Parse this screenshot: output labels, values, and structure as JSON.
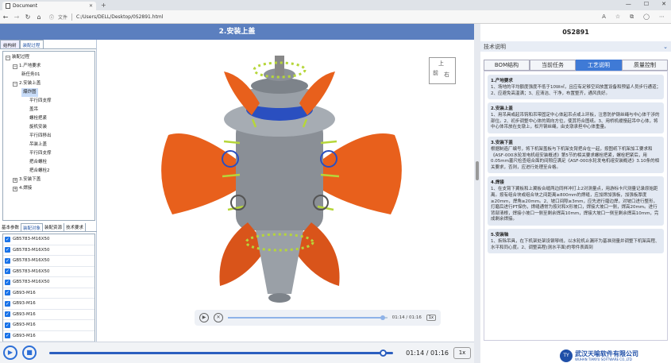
{
  "browser": {
    "tab_title": "Document",
    "window_controls": [
      "—",
      "☐",
      "✕"
    ],
    "file_label": "文件",
    "url": "C:/Users/DELL/Desktop/0S2891.html"
  },
  "header": {
    "title": "2.安装上盖"
  },
  "left_panel": {
    "tabs": [
      "结构树",
      "装配过程"
    ],
    "tree": [
      {
        "label": "装配过程",
        "level": 0,
        "toggle": "−"
      },
      {
        "label": "1.产地要求",
        "level": 1,
        "toggle": "−"
      },
      {
        "label": "新任务01",
        "level": 2,
        "toggle": ""
      },
      {
        "label": "2.安装上盖",
        "level": 1,
        "toggle": "−"
      },
      {
        "label": "爆炸图",
        "level": 2,
        "toggle": "",
        "selected": true
      },
      {
        "label": "平行四支撑",
        "level": 3,
        "toggle": ""
      },
      {
        "label": "盖吊",
        "level": 3,
        "toggle": ""
      },
      {
        "label": "螺栓把紧",
        "level": 3,
        "toggle": ""
      },
      {
        "label": "旋机安装",
        "level": 3,
        "toggle": ""
      },
      {
        "label": "平行四移出",
        "level": 3,
        "toggle": ""
      },
      {
        "label": "吊装上盖",
        "level": 3,
        "toggle": ""
      },
      {
        "label": "平行四支撑",
        "level": 3,
        "toggle": ""
      },
      {
        "label": "把合螺栓",
        "level": 3,
        "toggle": ""
      },
      {
        "label": "把合螺栓2",
        "level": 3,
        "toggle": ""
      },
      {
        "label": "3.安装下盖",
        "level": 1,
        "toggle": "+"
      },
      {
        "label": "4.焊接",
        "level": 1,
        "toggle": "+"
      }
    ],
    "bottom_tabs": [
      "基本参数",
      "装配对象",
      "装配资源",
      "技术要求"
    ],
    "parts": [
      "GB5783-M16X50",
      "GB5783-M16X50",
      "GB5783-M16X50",
      "GB5783-M16X50",
      "GB5783-M16X50",
      "GB93-M16",
      "GB93-M16",
      "GB93-M16",
      "GB93-M16",
      "GB93-M16"
    ]
  },
  "viewport": {
    "cube_faces": [
      "上",
      "前",
      "右"
    ],
    "mini_player": {
      "time": "01:14 / 01:16",
      "speed": "1x",
      "progress": 0.97
    }
  },
  "player": {
    "time": "01:14 / 01:16",
    "speed": "1x",
    "progress": 0.97,
    "play_icon": "▶",
    "stop_icon": "■"
  },
  "right_panel": {
    "title": "0S2891",
    "section": "技术说明",
    "tabs": [
      "BOM结构",
      "当前任务",
      "工艺说明",
      "质量控制"
    ],
    "active_tab": 2,
    "cards": [
      {
        "title": "1.产地要求",
        "text": "1、场地的平均额度强度不低于10W㎡，且应有足够空间放置设备和预留人员步行通道；2、应避免高温满；3、应清洁、干净，布置整齐，通风良好。"
      },
      {
        "title": "2.安装上盖",
        "text": "1、用吊具或起吊钩和吊带固定中心体起吊点或上环板，注意防护钢丝绳与中心体干涉的部位。2、初步调整中心体的周向方位，使其符合图纸。3、用桥机缓慢起吊中心体，将中心体吊放在支墩上，松开钢丝绳，由支墩承担中心体重量。"
      },
      {
        "title": "3.安装下盖",
        "text": "根据制造厂编号，将下机架盖板与下机架支臂把合在一起，按图纸下机架加工要求和《ASF-000水轮发电机组安装概述》第5节的相关要求螺栓把紧，螺栓把紧后，用0.05mm塞尺检查组合面的间隙应满足《ASF-000水轮发电机组安装概述》3.10条的相关要求，否则，应进行处理至合格。"
      },
      {
        "title": "4.焊接",
        "text": "1、在支臂下翼板和上翼板合缝两边同样冲打上2对测量点，用游标卡尺测量记录原始距离。按有组合块或组合块之间距离≥800mm的焊缝，应加焊加强板，加强板厚度≥20mm，焊角≥20mm。2、坡口间隙≥3mm，应先进行磨边焊，对坡口进行整形，打磨后进行PT探伤，焊缝通常为按对和X形坡口，焊接大坡口一侧，焊高20mm。进行背部清根，焊接小坡口一侧至剩余焊高10mm，焊接大坡口一侧至剩余焊高10mm，完成剩余焊接。"
      },
      {
        "title": "5.安装轴",
        "text": "1、拆除吊具，在下机架处架设钢琴线，以水轮机止漏环为基准测量并调整下机架高程、水平和同心度。2、调整高程(测水平面)的零件表面到"
      }
    ],
    "logo": {
      "mark": "TY",
      "cn": "武汉天喻软件有限公司",
      "en": "WUHAN TIANYU SOFTWARE CO.,LTD"
    }
  },
  "colors": {
    "accent": "#5b7fbf",
    "tab_active": "#3f7ad6",
    "orange": "#e8601c",
    "blue_part": "#2a4fc0",
    "green_bolts": "#b6d63a"
  }
}
